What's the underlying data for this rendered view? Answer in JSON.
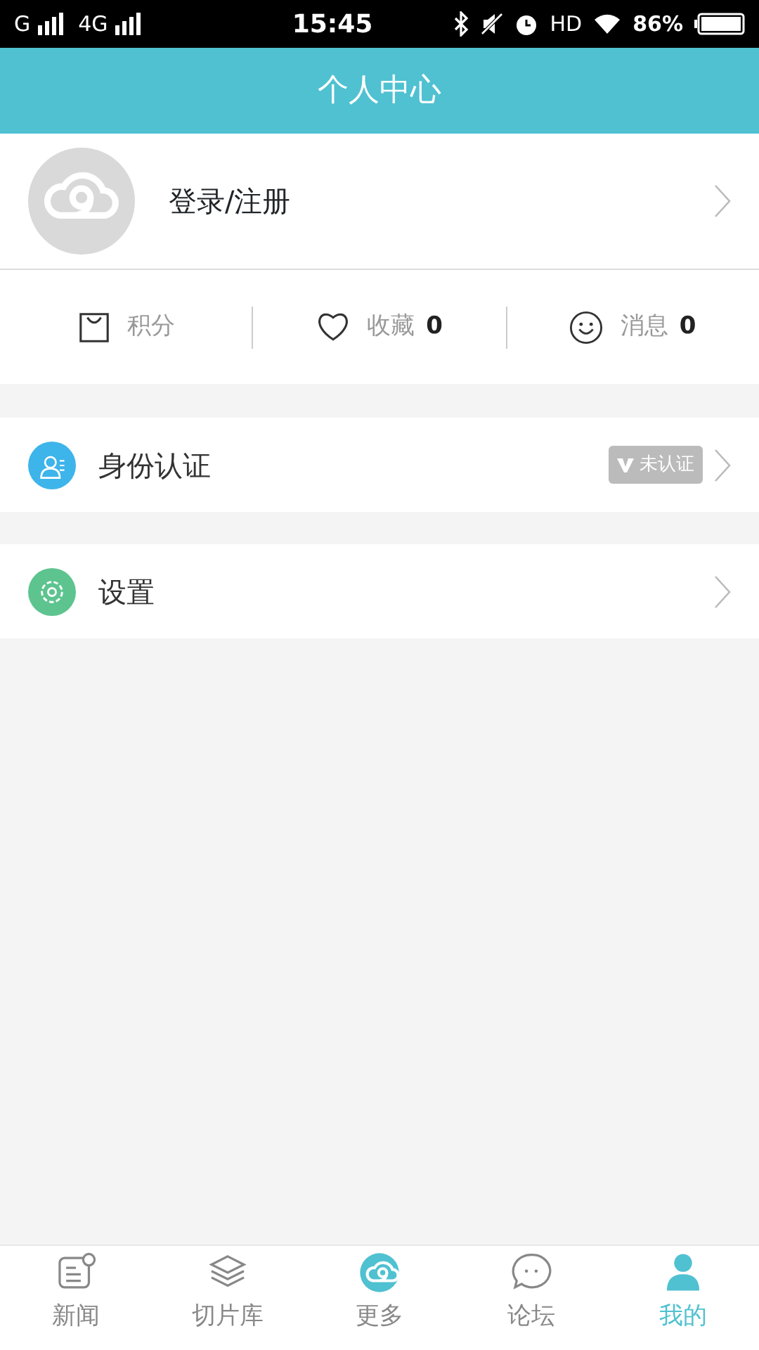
{
  "status_bar": {
    "sim1": "G",
    "sim2": "4G",
    "time": "15:45",
    "hd": "HD",
    "battery": "86%"
  },
  "header": {
    "title": "个人中心"
  },
  "profile": {
    "label": "登录/注册"
  },
  "stats": [
    {
      "kind": "points",
      "label": "积分"
    },
    {
      "kind": "favorites",
      "label": "收藏",
      "count": "0"
    },
    {
      "kind": "messages",
      "label": "消息",
      "count": "0"
    }
  ],
  "menu": [
    {
      "kind": "identity",
      "label": "身份认证",
      "badge": "未认证"
    },
    {
      "kind": "settings",
      "label": "设置"
    }
  ],
  "tabs": [
    {
      "kind": "news",
      "label": "新闻",
      "selected": false
    },
    {
      "kind": "layers",
      "label": "切片库",
      "selected": false
    },
    {
      "kind": "more",
      "label": "更多",
      "selected": false
    },
    {
      "kind": "forum",
      "label": "论坛",
      "selected": false
    },
    {
      "kind": "me",
      "label": "我的",
      "selected": true
    }
  ]
}
